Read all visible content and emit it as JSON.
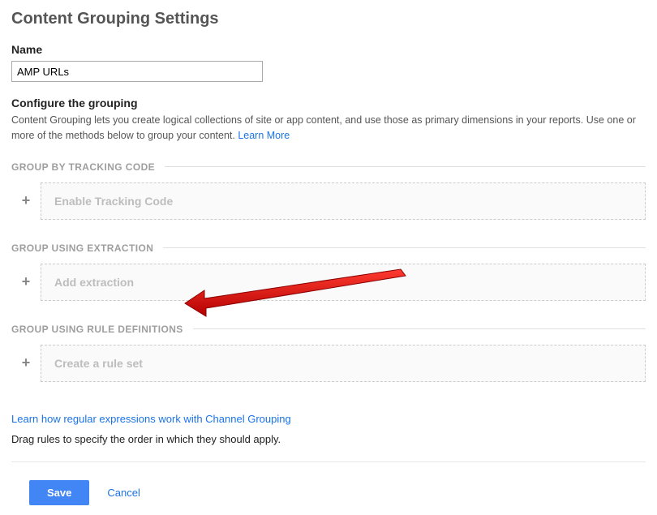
{
  "page": {
    "title": "Content Grouping Settings",
    "name_label": "Name",
    "name_value": "AMP URLs",
    "configure_title": "Configure the grouping",
    "configure_desc": "Content Grouping lets you create logical collections of site or app content, and use those as primary dimensions in your reports. Use one or more of the methods below to group your content. ",
    "learn_more": "Learn More"
  },
  "sections": {
    "tracking": {
      "title": "GROUP BY TRACKING CODE",
      "box_label": "Enable Tracking Code"
    },
    "extraction": {
      "title": "GROUP USING EXTRACTION",
      "box_label": "Add extraction"
    },
    "rules": {
      "title": "GROUP USING RULE DEFINITIONS",
      "box_label": "Create a rule set"
    }
  },
  "footer": {
    "regex_link": "Learn how regular expressions work with Channel Grouping",
    "drag_note": "Drag rules to specify the order in which they should apply.",
    "save": "Save",
    "cancel": "Cancel"
  },
  "annotation": {
    "arrow_target": "rules-section-title"
  }
}
